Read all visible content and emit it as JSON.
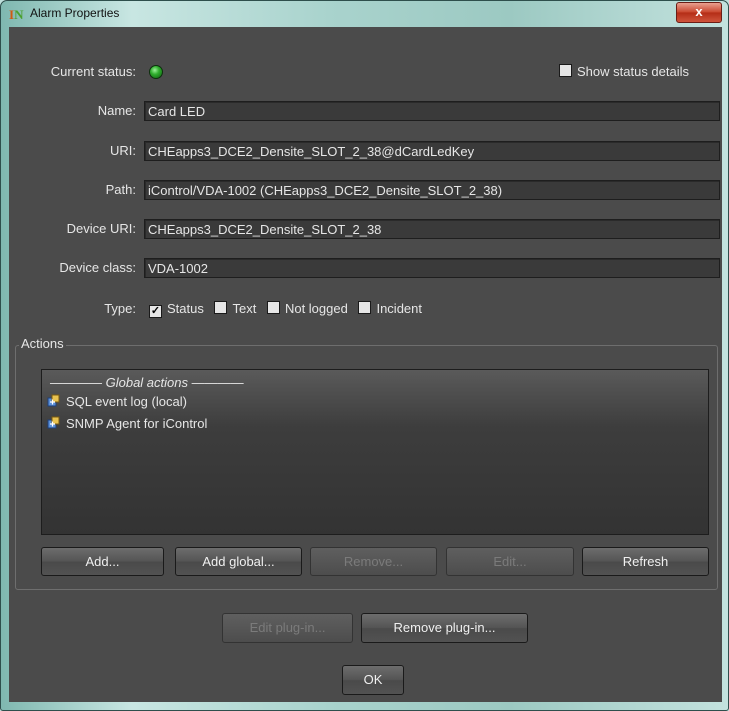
{
  "window": {
    "title": "Alarm Properties",
    "close_glyph": "x"
  },
  "status": {
    "label": "Current status:",
    "led_color": "#2fae2d",
    "show_details_label": "Show status details",
    "show_details_checked": false
  },
  "fields": {
    "name": {
      "label": "Name:",
      "value": "Card LED"
    },
    "uri": {
      "label": "URI:",
      "value": "CHEapps3_DCE2_Densite_SLOT_2_38@dCardLedKey"
    },
    "path": {
      "label": "Path:",
      "value": "iControl/VDA-1002 (CHEapps3_DCE2_Densite_SLOT_2_38)"
    },
    "device_uri": {
      "label": "Device URI:",
      "value": "CHEapps3_DCE2_Densite_SLOT_2_38"
    },
    "device_class": {
      "label": "Device class:",
      "value": "VDA-1002"
    }
  },
  "type": {
    "label": "Type:",
    "options": [
      {
        "label": "Status",
        "checked": true
      },
      {
        "label": "Text",
        "checked": false
      },
      {
        "label": "Not logged",
        "checked": false
      },
      {
        "label": "Incident",
        "checked": false
      }
    ]
  },
  "actions": {
    "group_title": "Actions",
    "global_header": "———— Global actions ————",
    "items": [
      {
        "label": "SQL event log (local)",
        "icon": "plugin-icon"
      },
      {
        "label": "SNMP Agent for iControl",
        "icon": "plugin-icon"
      }
    ],
    "buttons": {
      "add": "Add...",
      "add_global": "Add global...",
      "remove": "Remove...",
      "edit": "Edit...",
      "refresh": "Refresh"
    }
  },
  "footer": {
    "edit_plugin": "Edit plug-in...",
    "remove_plugin": "Remove plug-in...",
    "ok": "OK"
  },
  "colors": {
    "client_bg": "#4b4b4b",
    "field_bg": "#3a3a3a",
    "text": "#e6e6e6",
    "disabled_text": "#7b7b7b"
  }
}
